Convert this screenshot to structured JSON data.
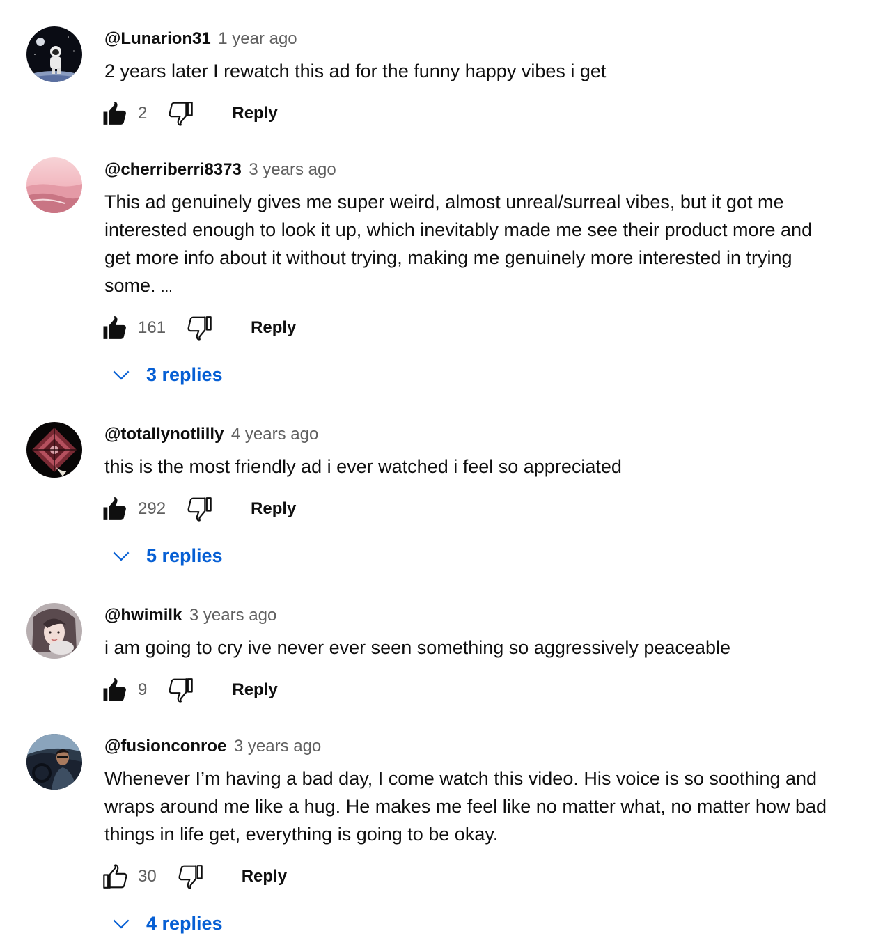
{
  "comments": [
    {
      "author": "@Lunarion31",
      "time": "1 year ago",
      "text": "2 years later I rewatch this ad for the funny happy vibes i get",
      "likes": "2",
      "liked": true,
      "reply_label": "Reply",
      "avatar_icon": "astronaut-avatar"
    },
    {
      "author": "@cherriberri8373",
      "time": "3 years ago",
      "text_lines": [
        "This ad genuinely gives me super weird, almost unreal/surreal vibes, but it got me",
        "interested enough to look it up, which inevitably made me see their product more and",
        "get more info about it without trying, making me genuinely more interested in trying",
        "some."
      ],
      "more": "...",
      "likes": "161",
      "liked": true,
      "reply_label": "Reply",
      "replies_label": "3 replies",
      "avatar_icon": "pink-beach-avatar"
    },
    {
      "author": "@totallynotlilly",
      "time": "4 years ago",
      "text": "this is the most friendly ad i ever watched i feel so appreciated",
      "likes": "292",
      "liked": true,
      "reply_label": "Reply",
      "replies_label": "5 replies",
      "avatar_icon": "red-pattern-avatar"
    },
    {
      "author": "@hwimilk",
      "time": "3 years ago",
      "text": "i am going to cry ive never ever seen something so aggressively peaceable",
      "likes": "9",
      "liked": true,
      "reply_label": "Reply",
      "avatar_icon": "portrait-avatar"
    },
    {
      "author": "@fusionconroe",
      "time": "3 years ago",
      "text_lines": [
        "Whenever I’m having a bad day, I come watch this video. His voice is so soothing and",
        "wraps around me like a hug. He makes me feel like no matter what, no matter how bad",
        "things in life get, everything is going to be okay."
      ],
      "likes": "30",
      "liked": false,
      "reply_label": "Reply",
      "replies_label": "4 replies",
      "avatar_icon": "car-selfie-avatar"
    }
  ],
  "colors": {
    "text": "#0f0f0f",
    "secondary": "#606060",
    "link": "#065fd4"
  }
}
